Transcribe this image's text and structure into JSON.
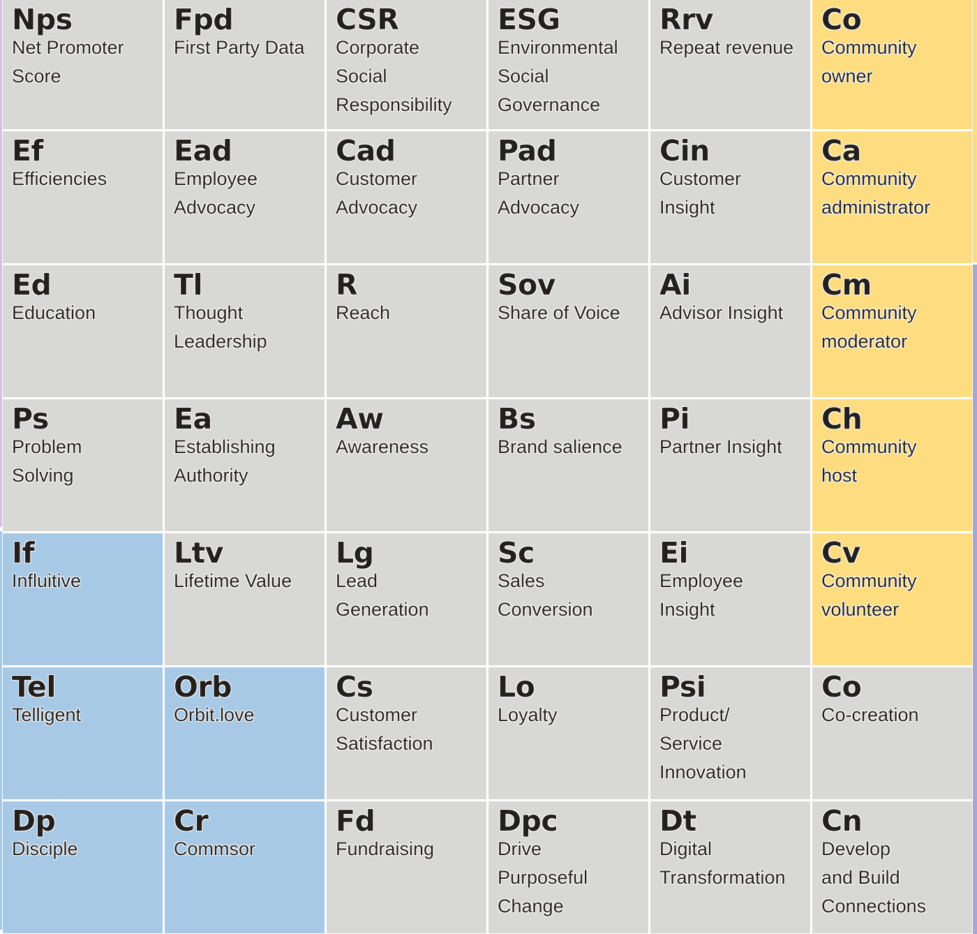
{
  "colors": {
    "default": "#d8d8d7",
    "blue": "#a8c9e6",
    "yellow": "#fedd81",
    "edge_left_top": "#d8bfe0",
    "edge_left_bottom": "#a8c9e6",
    "edge_right_top": "#fedd81",
    "edge_right_bottom": "#a6a8d2"
  },
  "rows": [
    [
      {
        "symbol": "Nps",
        "name": "Net Promoter\nScore",
        "color": "default"
      },
      {
        "symbol": "Fpd",
        "name": "First Party Data",
        "color": "default"
      },
      {
        "symbol": "CSR",
        "name": "Corporate\nSocial\nResponsibility",
        "color": "default"
      },
      {
        "symbol": "ESG",
        "name": "Environmental\nSocial\nGovernance",
        "color": "default"
      },
      {
        "symbol": "Rrv",
        "name": "Repeat revenue",
        "color": "default"
      },
      {
        "symbol": "Co",
        "name": "Community\nowner",
        "color": "yellow"
      }
    ],
    [
      {
        "symbol": "Ef",
        "name": "Efficiencies",
        "color": "default"
      },
      {
        "symbol": "Ead",
        "name": "Employee\nAdvocacy",
        "color": "default"
      },
      {
        "symbol": "Cad",
        "name": "Customer\nAdvocacy",
        "color": "default"
      },
      {
        "symbol": "Pad",
        "name": "Partner\nAdvocacy",
        "color": "default"
      },
      {
        "symbol": "Cin",
        "name": "Customer\nInsight",
        "color": "default"
      },
      {
        "symbol": "Ca",
        "name": "Community\nadministrator",
        "color": "yellow"
      }
    ],
    [
      {
        "symbol": "Ed",
        "name": "Education",
        "color": "default"
      },
      {
        "symbol": "Tl",
        "name": "Thought\nLeadership",
        "color": "default"
      },
      {
        "symbol": "R",
        "name": "Reach",
        "color": "default"
      },
      {
        "symbol": "Sov",
        "name": "Share of Voice",
        "color": "default"
      },
      {
        "symbol": "Ai",
        "name": "Advisor Insight",
        "color": "default"
      },
      {
        "symbol": "Cm",
        "name": "Community\nmoderator",
        "color": "yellow"
      }
    ],
    [
      {
        "symbol": "Ps",
        "name": "Problem\nSolving",
        "color": "default"
      },
      {
        "symbol": "Ea",
        "name": "Establishing\nAuthority",
        "color": "default"
      },
      {
        "symbol": "Aw",
        "name": "Awareness",
        "color": "default"
      },
      {
        "symbol": "Bs",
        "name": "Brand salience",
        "color": "default"
      },
      {
        "symbol": "Pi",
        "name": "Partner Insight",
        "color": "default"
      },
      {
        "symbol": "Ch",
        "name": "Community\nhost",
        "color": "yellow"
      }
    ],
    [
      {
        "symbol": "If",
        "name": "Influitive",
        "color": "blue"
      },
      {
        "symbol": "Ltv",
        "name": "Lifetime Value",
        "color": "default"
      },
      {
        "symbol": "Lg",
        "name": "Lead\nGeneration",
        "color": "default"
      },
      {
        "symbol": "Sc",
        "name": "Sales\nConversion",
        "color": "default"
      },
      {
        "symbol": "Ei",
        "name": "Employee\nInsight",
        "color": "default"
      },
      {
        "symbol": "Cv",
        "name": "Community\nvolunteer",
        "color": "yellow"
      }
    ],
    [
      {
        "symbol": "Tel",
        "name": "Telligent",
        "color": "blue"
      },
      {
        "symbol": "Orb",
        "name": "Orbit.love",
        "color": "blue"
      },
      {
        "symbol": "Cs",
        "name": "Customer\nSatisfaction",
        "color": "default"
      },
      {
        "symbol": "Lo",
        "name": "Loyalty",
        "color": "default"
      },
      {
        "symbol": "Psi",
        "name": "Product/\nService\nInnovation",
        "color": "default"
      },
      {
        "symbol": "Co",
        "name": "Co-creation",
        "color": "default"
      }
    ],
    [
      {
        "symbol": "Dp",
        "name": "Disciple",
        "color": "blue"
      },
      {
        "symbol": "Cr",
        "name": "Commsor",
        "color": "blue"
      },
      {
        "symbol": "Fd",
        "name": "Fundraising",
        "color": "default"
      },
      {
        "symbol": "Dpc",
        "name": "Drive\nPurposeful\nChange",
        "color": "default"
      },
      {
        "symbol": "Dt",
        "name": "Digital\nTransformation",
        "color": "default"
      },
      {
        "symbol": "Cn",
        "name": "Develop\nand Build\nConnections",
        "color": "default"
      }
    ]
  ]
}
